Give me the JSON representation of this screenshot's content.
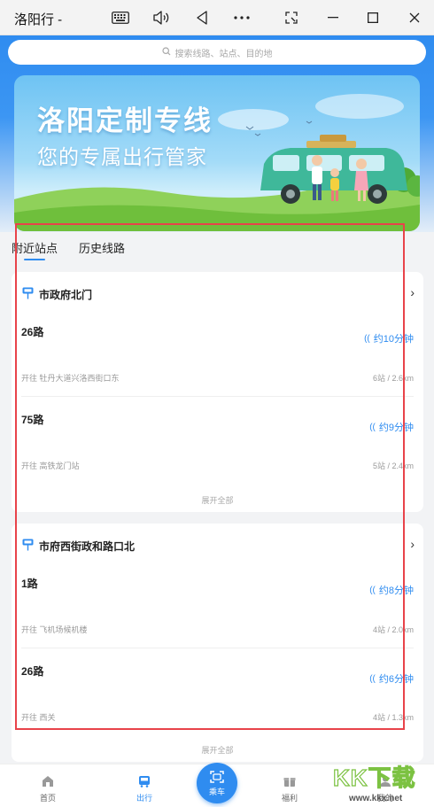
{
  "window": {
    "title": "洛阳行 -",
    "controls": [
      "keyboard-icon",
      "volume-icon",
      "back-icon",
      "more-icon",
      "screenshot-icon",
      "minimize-icon",
      "maximize-icon",
      "close-icon"
    ]
  },
  "search": {
    "placeholder": "搜索线路、站点、目的地"
  },
  "banner": {
    "title": "洛阳定制专线",
    "subtitle": "您的专属出行管家"
  },
  "tabs": [
    {
      "label": "附近站点",
      "active": true
    },
    {
      "label": "历史线路",
      "active": false
    }
  ],
  "stops": [
    {
      "name": "市政府北门",
      "routes": [
        {
          "route": "26路",
          "eta": "约10分钟",
          "direction": "开往 牡丹大道兴洛西街口东",
          "distance": "6站 / 2.6km"
        },
        {
          "route": "75路",
          "eta": "约9分钟",
          "direction": "开往 高铁龙门站",
          "distance": "5站 / 2.4km"
        }
      ],
      "expand_label": "展开全部"
    },
    {
      "name": "市府西街政和路口北",
      "routes": [
        {
          "route": "1路",
          "eta": "约8分钟",
          "direction": "开往 飞机场候机楼",
          "distance": "4站 / 2.0km"
        },
        {
          "route": "26路",
          "eta": "约6分钟",
          "direction": "开往 西关",
          "distance": "4站 / 1.3km"
        }
      ],
      "expand_label": "展开全部"
    }
  ],
  "bottom_nav": [
    {
      "label": "首页",
      "icon": "home-icon",
      "active": false
    },
    {
      "label": "出行",
      "icon": "bus-icon",
      "active": true
    },
    {
      "label": "乘车",
      "icon": "scan-icon",
      "active": false
    },
    {
      "label": "福利",
      "icon": "gift-icon",
      "active": false
    },
    {
      "label": "我的",
      "icon": "user-icon",
      "active": false
    }
  ],
  "watermark": {
    "text": "KK下载",
    "url": "www.kkx.net"
  },
  "colors": {
    "accent": "#2f8cf0",
    "highlight": "#e8434a",
    "watermark": "#7cc242"
  }
}
